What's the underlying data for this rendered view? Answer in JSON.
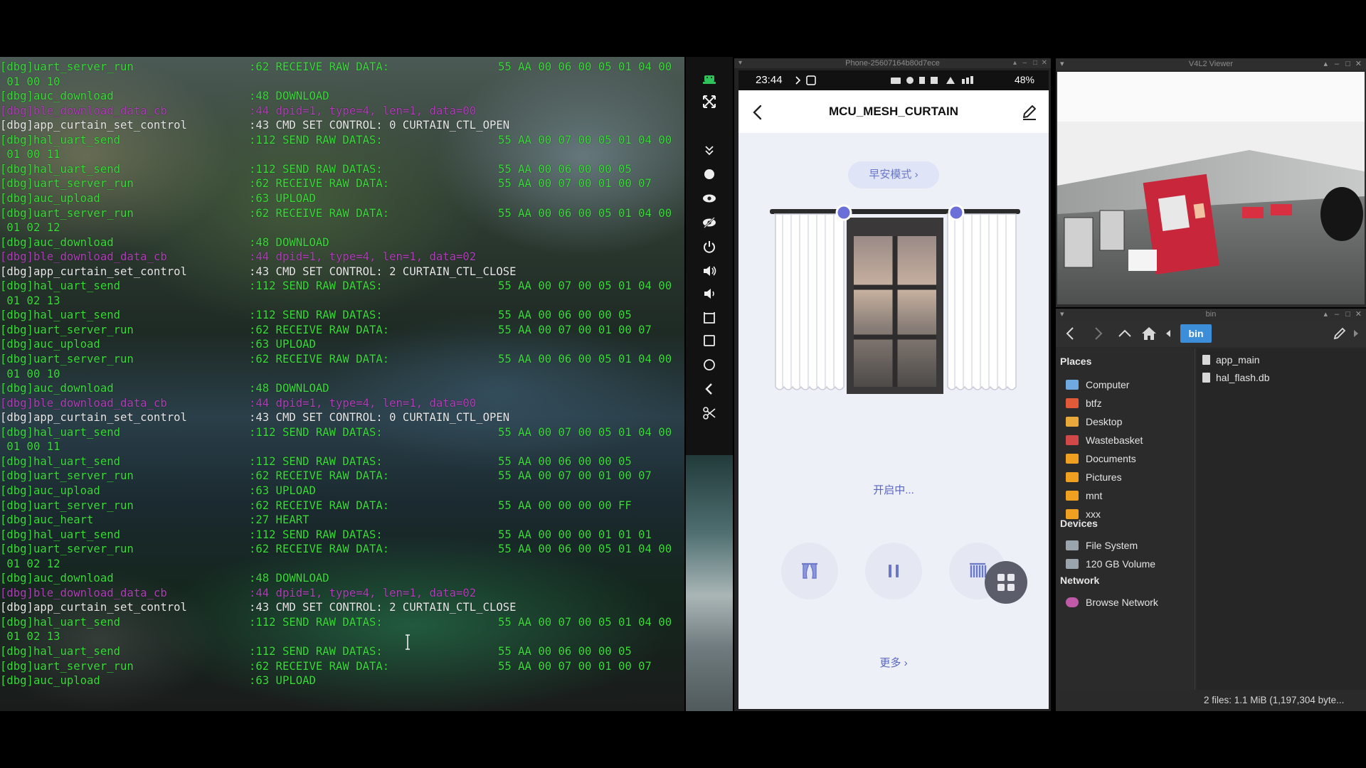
{
  "terminal": {
    "lines": [
      {
        "c": "green",
        "a": "[dbg]uart_server_run",
        "b": ":62 RECEIVE RAW DATA:",
        "d": "55 AA 00 06 00 05 01 04 00"
      },
      {
        "c": "green",
        "a": " 01 00 10",
        "b": "",
        "d": ""
      },
      {
        "c": "green",
        "a": "[dbg]auc_download",
        "b": ":48 DOWNLOAD",
        "d": ""
      },
      {
        "c": "magenta",
        "a": "[dbg]ble_download_data_cb",
        "b": ":44 dpid=1, type=4, len=1, data=00",
        "d": ""
      },
      {
        "c": "white",
        "a": "[dbg]app_curtain_set_control",
        "b": ":43 CMD SET CONTROL: 0 CURTAIN_CTL_OPEN",
        "d": ""
      },
      {
        "c": "green",
        "a": "[dbg]hal_uart_send",
        "b": ":112 SEND RAW DATAS:",
        "d": "55 AA 00 07 00 05 01 04 00"
      },
      {
        "c": "green",
        "a": " 01 00 11",
        "b": "",
        "d": ""
      },
      {
        "c": "green",
        "a": "[dbg]hal_uart_send",
        "b": ":112 SEND RAW DATAS:",
        "d": "55 AA 00 06 00 00 05"
      },
      {
        "c": "green",
        "a": "[dbg]uart_server_run",
        "b": ":62 RECEIVE RAW DATA:",
        "d": "55 AA 00 07 00 01 00 07"
      },
      {
        "c": "green",
        "a": "[dbg]auc_upload",
        "b": ":63 UPLOAD",
        "d": ""
      },
      {
        "c": "green",
        "a": "[dbg]uart_server_run",
        "b": ":62 RECEIVE RAW DATA:",
        "d": "55 AA 00 06 00 05 01 04 00"
      },
      {
        "c": "green",
        "a": " 01 02 12",
        "b": "",
        "d": ""
      },
      {
        "c": "green",
        "a": "[dbg]auc_download",
        "b": ":48 DOWNLOAD",
        "d": ""
      },
      {
        "c": "magenta",
        "a": "[dbg]ble_download_data_cb",
        "b": ":44 dpid=1, type=4, len=1, data=02",
        "d": ""
      },
      {
        "c": "white",
        "a": "[dbg]app_curtain_set_control",
        "b": ":43 CMD SET CONTROL: 2 CURTAIN_CTL_CLOSE",
        "d": ""
      },
      {
        "c": "green",
        "a": "[dbg]hal_uart_send",
        "b": ":112 SEND RAW DATAS:",
        "d": "55 AA 00 07 00 05 01 04 00"
      },
      {
        "c": "green",
        "a": " 01 02 13",
        "b": "",
        "d": ""
      },
      {
        "c": "green",
        "a": "[dbg]hal_uart_send",
        "b": ":112 SEND RAW DATAS:",
        "d": "55 AA 00 06 00 00 05"
      },
      {
        "c": "green",
        "a": "[dbg]uart_server_run",
        "b": ":62 RECEIVE RAW DATA:",
        "d": "55 AA 00 07 00 01 00 07"
      },
      {
        "c": "green",
        "a": "[dbg]auc_upload",
        "b": ":63 UPLOAD",
        "d": ""
      },
      {
        "c": "green",
        "a": "[dbg]uart_server_run",
        "b": ":62 RECEIVE RAW DATA:",
        "d": "55 AA 00 06 00 05 01 04 00"
      },
      {
        "c": "green",
        "a": " 01 00 10",
        "b": "",
        "d": ""
      },
      {
        "c": "green",
        "a": "[dbg]auc_download",
        "b": ":48 DOWNLOAD",
        "d": ""
      },
      {
        "c": "magenta",
        "a": "[dbg]ble_download_data_cb",
        "b": ":44 dpid=1, type=4, len=1, data=00",
        "d": ""
      },
      {
        "c": "white",
        "a": "[dbg]app_curtain_set_control",
        "b": ":43 CMD SET CONTROL: 0 CURTAIN_CTL_OPEN",
        "d": ""
      },
      {
        "c": "green",
        "a": "[dbg]hal_uart_send",
        "b": ":112 SEND RAW DATAS:",
        "d": "55 AA 00 07 00 05 01 04 00"
      },
      {
        "c": "green",
        "a": " 01 00 11",
        "b": "",
        "d": ""
      },
      {
        "c": "green",
        "a": "[dbg]hal_uart_send",
        "b": ":112 SEND RAW DATAS:",
        "d": "55 AA 00 06 00 00 05"
      },
      {
        "c": "green",
        "a": "[dbg]uart_server_run",
        "b": ":62 RECEIVE RAW DATA:",
        "d": "55 AA 00 07 00 01 00 07"
      },
      {
        "c": "green",
        "a": "[dbg]auc_upload",
        "b": ":63 UPLOAD",
        "d": ""
      },
      {
        "c": "green",
        "a": "[dbg]uart_server_run",
        "b": ":62 RECEIVE RAW DATA:",
        "d": "55 AA 00 00 00 00 FF"
      },
      {
        "c": "green",
        "a": "[dbg]auc_heart",
        "b": ":27 HEART",
        "d": ""
      },
      {
        "c": "green",
        "a": "[dbg]hal_uart_send",
        "b": ":112 SEND RAW DATAS:",
        "d": "55 AA 00 00 00 01 01 01"
      },
      {
        "c": "green",
        "a": "[dbg]uart_server_run",
        "b": ":62 RECEIVE RAW DATA:",
        "d": "55 AA 00 06 00 05 01 04 00"
      },
      {
        "c": "green",
        "a": " 01 02 12",
        "b": "",
        "d": ""
      },
      {
        "c": "green",
        "a": "[dbg]auc_download",
        "b": ":48 DOWNLOAD",
        "d": ""
      },
      {
        "c": "magenta",
        "a": "[dbg]ble_download_data_cb",
        "b": ":44 dpid=1, type=4, len=1, data=02",
        "d": ""
      },
      {
        "c": "white",
        "a": "[dbg]app_curtain_set_control",
        "b": ":43 CMD SET CONTROL: 2 CURTAIN_CTL_CLOSE",
        "d": ""
      },
      {
        "c": "green",
        "a": "[dbg]hal_uart_send",
        "b": ":112 SEND RAW DATAS:",
        "d": "55 AA 00 07 00 05 01 04 00"
      },
      {
        "c": "green",
        "a": " 01 02 13",
        "b": "",
        "d": ""
      },
      {
        "c": "green",
        "a": "[dbg]hal_uart_send",
        "b": ":112 SEND RAW DATAS:",
        "d": "55 AA 00 06 00 00 05"
      },
      {
        "c": "green",
        "a": "[dbg]uart_server_run",
        "b": ":62 RECEIVE RAW DATA:",
        "d": "55 AA 00 07 00 01 00 07"
      },
      {
        "c": "green",
        "a": "[dbg]auc_upload",
        "b": ":63 UPLOAD",
        "d": ""
      }
    ],
    "colors": {
      "green": "#3cdc3c",
      "white": "#e9e9e9",
      "magenta": "#b040b8"
    }
  },
  "side_toolbar": {
    "buttons": [
      "android-icon",
      "fullscreen-icon",
      "collapse-icon",
      "record-icon",
      "eye-icon",
      "eye-off-icon",
      "power-icon",
      "volume-up-icon",
      "volume-down-icon",
      "rotate-icon",
      "overview-icon",
      "home-icon",
      "back-icon",
      "screenshot-icon"
    ]
  },
  "phone": {
    "window_title": "Phone-25607164b80d7ece",
    "status": {
      "time": "23:44",
      "battery": "48%"
    },
    "app": {
      "title": "MCU_MESH_CURTAIN",
      "mode_chip": "早安模式 ›",
      "status_text": "开启中...",
      "more": "更多 ›"
    },
    "accent": "#6b78c8"
  },
  "v4l2": {
    "title": "V4L2 Viewer"
  },
  "file_manager": {
    "title": "bin",
    "path_button": "bin",
    "sections": {
      "places": "Places",
      "devices": "Devices",
      "network": "Network"
    },
    "places": [
      {
        "label": "Computer",
        "icon": "computer-icon"
      },
      {
        "label": "btfz",
        "icon": "home-folder-icon"
      },
      {
        "label": "Desktop",
        "icon": "desktop-folder-icon"
      },
      {
        "label": "Wastebasket",
        "icon": "trash-icon"
      },
      {
        "label": "Documents",
        "icon": "folder-icon"
      },
      {
        "label": "Pictures",
        "icon": "folder-icon"
      },
      {
        "label": "mnt",
        "icon": "folder-icon"
      },
      {
        "label": "xxx",
        "icon": "folder-icon"
      }
    ],
    "devices": [
      {
        "label": "File System",
        "icon": "drive-icon"
      },
      {
        "label": "120 GB Volume",
        "icon": "drive-icon"
      }
    ],
    "network": [
      {
        "label": "Browse Network",
        "icon": "network-icon"
      }
    ],
    "files": [
      "app_main",
      "hal_flash.db"
    ],
    "statusbar": "2 files: 1.1 MiB (1,197,304 byte..."
  }
}
